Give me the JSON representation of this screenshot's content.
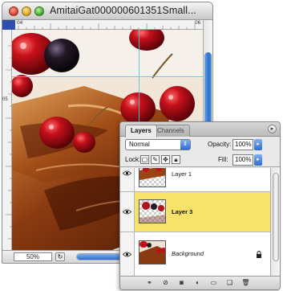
{
  "document": {
    "title": "AmitaiGat000000601351Small...",
    "zoom": "50%",
    "ruler_numbers": [
      "04",
      "05",
      "06"
    ],
    "nav_symbol": "↻"
  },
  "layers_palette": {
    "tabs": [
      {
        "label": "Layers",
        "active": true
      },
      {
        "label": "Channels",
        "active": false
      }
    ],
    "blend_mode": "Normal",
    "opacity_label": "Opacity:",
    "opacity_value": "100%",
    "lock_label": "Lock:",
    "fill_label": "Fill:",
    "fill_value": "100%",
    "layers": [
      {
        "name": "Layer 1",
        "visible": true,
        "selected": false
      },
      {
        "name": "Layer 3",
        "visible": true,
        "selected": true
      },
      {
        "name": "Background",
        "visible": true,
        "selected": false,
        "locked": true
      }
    ]
  },
  "colors": {
    "selected_layer": "#f7e36b",
    "accent_blue": "#2d6cd2"
  }
}
